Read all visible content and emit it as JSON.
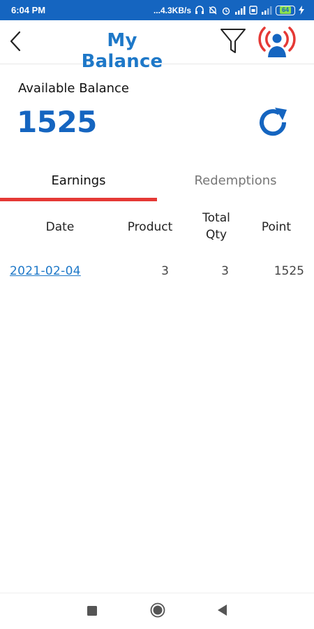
{
  "status_bar": {
    "time": "6:04 PM",
    "network_speed": "...4.3KB/s",
    "battery_level": "64",
    "icons": [
      "headphones-icon",
      "alarm-off-icon",
      "alarm-icon",
      "signal-icon",
      "sim-icon",
      "signal-icon",
      "battery-icon",
      "charging-icon"
    ]
  },
  "app_bar": {
    "title": "My Balance",
    "icons": [
      "back-arrow-icon",
      "filter-icon",
      "live-broadcast-user-icon"
    ],
    "accent_color": "#1e78c8"
  },
  "balance": {
    "label": "Available Balance",
    "value": "1525",
    "refresh_icon": "refresh-icon"
  },
  "tabs": [
    {
      "label": "Earnings",
      "active": true
    },
    {
      "label": "Redemptions",
      "active": false
    }
  ],
  "tab_indicator_color": "#e53935",
  "table": {
    "headers": {
      "date": "Date",
      "product": "Product",
      "total_qty_line1": "Total",
      "total_qty_line2": "Qty",
      "point": "Point"
    },
    "rows": [
      {
        "date": "2021-02-04",
        "product": "3",
        "total_qty": "3",
        "point": "1525"
      }
    ]
  },
  "nav_bar": {
    "icons": [
      "recents-square-icon",
      "home-circle-icon",
      "back-triangle-icon"
    ]
  }
}
